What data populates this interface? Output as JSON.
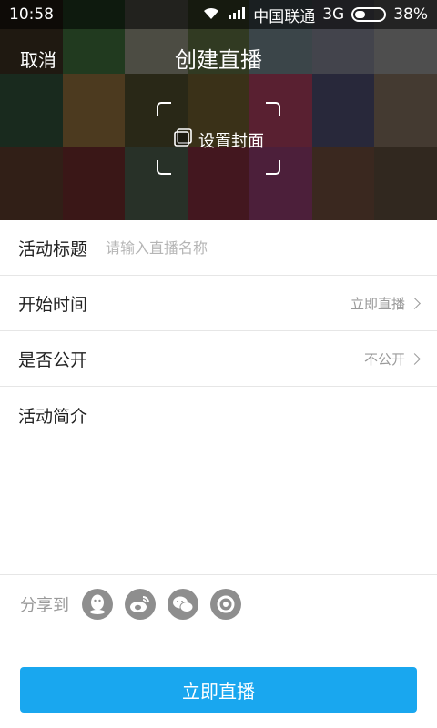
{
  "status_bar": {
    "time": "10:58",
    "carrier": "中国联通",
    "network": "3G",
    "battery": "38%",
    "battery_level_percent": 38,
    "icons": [
      "wifi-icon",
      "signal-icon",
      "battery-icon"
    ]
  },
  "header": {
    "cancel_label": "取消",
    "title": "创建直播",
    "cover_label": "设置封面",
    "cover_icon": "square-icon"
  },
  "form": {
    "title_label": "活动标题",
    "title_placeholder": "请输入直播名称",
    "title_value": "",
    "start_label": "开始时间",
    "start_value": "立即直播",
    "public_label": "是否公开",
    "public_value": "不公开",
    "intro_label": "活动简介",
    "intro_value": ""
  },
  "share": {
    "label": "分享到",
    "targets": [
      "qq-icon",
      "weibo-icon",
      "wechat-icon",
      "moments-icon"
    ]
  },
  "submit_label": "立即直播",
  "colors": {
    "accent": "#19a7ef",
    "muted": "#9a9a9a",
    "share_icon_bg": "#8e8e8e"
  }
}
